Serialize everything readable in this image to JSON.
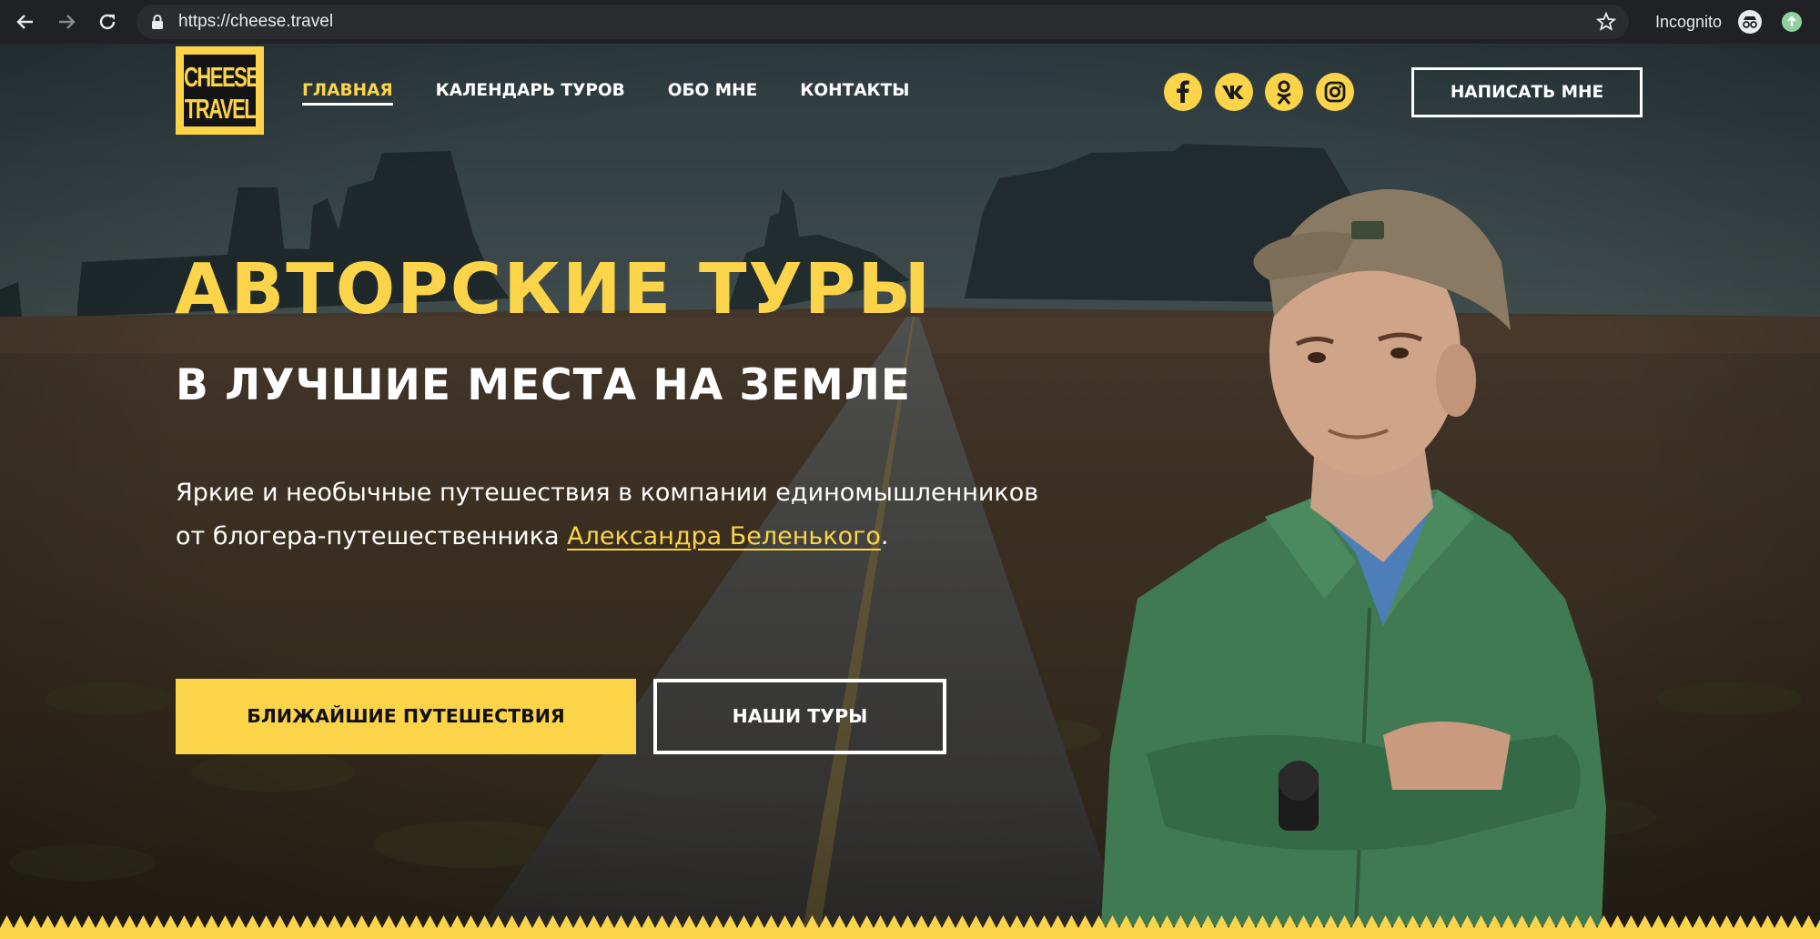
{
  "browser": {
    "url": "https://cheese.travel",
    "incognito_label": "Incognito",
    "icons": [
      "back-arrow-icon",
      "forward-arrow-icon",
      "reload-icon",
      "lock-icon",
      "star-icon",
      "incognito-icon",
      "update-icon"
    ]
  },
  "site": {
    "logo": {
      "line1": "CHEESE",
      "line2": "TRAVEL"
    },
    "nav": [
      {
        "label": "ГЛАВНАЯ",
        "active": true
      },
      {
        "label": "КАЛЕНДАРЬ ТУРОВ",
        "active": false
      },
      {
        "label": "ОБО МНЕ",
        "active": false
      },
      {
        "label": "КОНТАКТЫ",
        "active": false
      }
    ],
    "social": [
      "facebook-icon",
      "vk-icon",
      "odnoklassniki-icon",
      "instagram-icon"
    ],
    "write_button": "НАПИСАТЬ МНЕ",
    "hero": {
      "title": "АВТОРСКИЕ ТУРЫ",
      "subtitle": "В ЛУЧШИЕ МЕСТА НА ЗЕМЛЕ",
      "lead_line1": "Яркие и необычные путешествия в компании единомышленников",
      "lead_line2_prefix": "от блогера-путешественника ",
      "lead_link": "Александра Беленького",
      "lead_line2_suffix": ".",
      "primary_button": "БЛИЖАЙШИЕ ПУТЕШЕСТВИЯ",
      "secondary_button": "НАШИ ТУРЫ"
    }
  },
  "colors": {
    "accent": "#fcd449",
    "chrome": "#202124",
    "omnibox": "#2b2c2f",
    "jacket": "#3f7a52"
  }
}
